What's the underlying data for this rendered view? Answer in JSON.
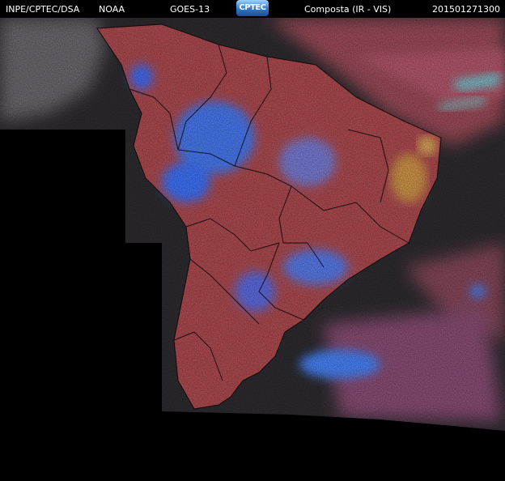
{
  "header": {
    "institution": "INPE/CPTEC/DSA",
    "agency": "NOAA",
    "satellite": "GOES-13",
    "logo_text": "CPTEC",
    "product": "Composta (IR - VIS)",
    "timestamp": "201501271300"
  },
  "colors": {
    "background": "#000000",
    "land_warm": "#c8504a",
    "cloud_cold": "#3f7fff",
    "ocean_dark": "#2e2c30",
    "border": "#000000"
  }
}
